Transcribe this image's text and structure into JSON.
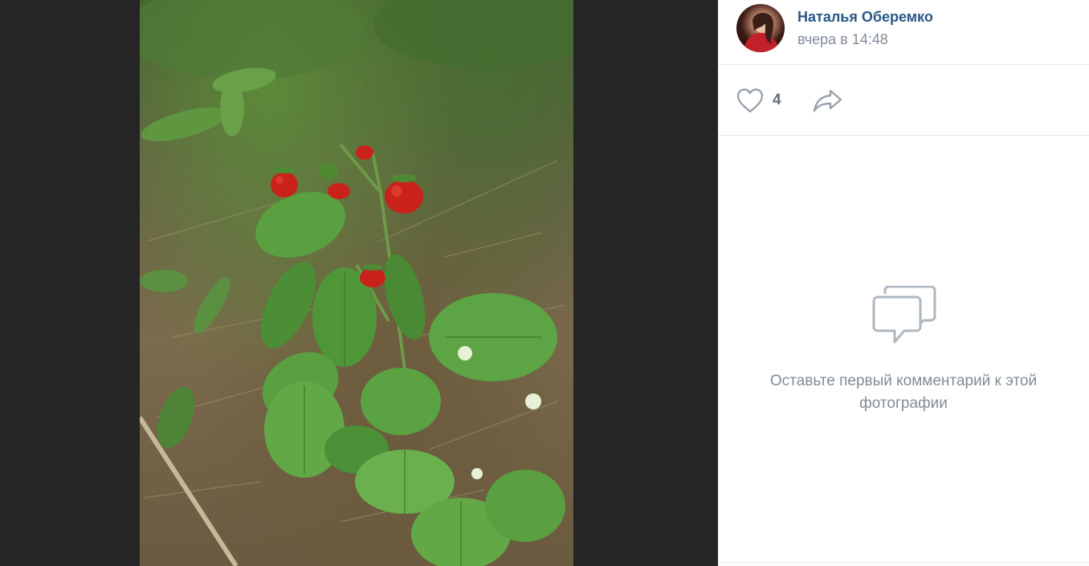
{
  "viewer": {
    "photo_subject": "wild-strawberry-photo"
  },
  "author": {
    "name": "Наталья Оберемко",
    "time": "вчера в 14:48"
  },
  "actions": {
    "like_count": "4",
    "like_icon": "heart-icon",
    "share_icon": "share-arrow-icon"
  },
  "comments": {
    "empty_icon": "comments-icon",
    "empty_text": "Оставьте первый комментарий к этой фотографии"
  },
  "colors": {
    "viewer_bg": "#252525",
    "link": "#2a5885",
    "muted": "#818c99",
    "icon": "#99a2ad"
  }
}
